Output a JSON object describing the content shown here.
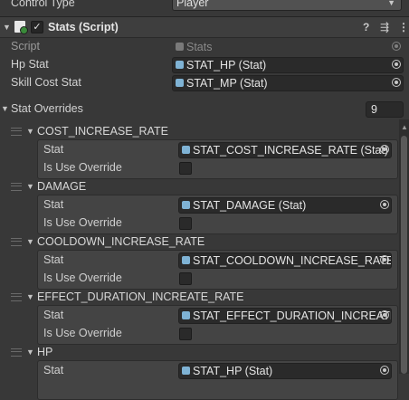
{
  "control_type": {
    "label": "Control Type",
    "value": "Player"
  },
  "component": {
    "title": "Stats (Script)",
    "enabled": true
  },
  "fields": {
    "script": {
      "label": "Script",
      "value": "Stats"
    },
    "hp_stat": {
      "label": "Hp Stat",
      "value": "STAT_HP (Stat)"
    },
    "skill_cost_stat": {
      "label": "Skill Cost Stat",
      "value": "STAT_MP (Stat)"
    }
  },
  "stat_overrides": {
    "label": "Stat Overrides",
    "count": "9",
    "stat_label": "Stat",
    "override_label": "Is Use Override",
    "items": [
      {
        "title": "COST_INCREASE_RATE",
        "stat": "STAT_COST_INCREASE_RATE (Stat)"
      },
      {
        "title": "DAMAGE",
        "stat": "STAT_DAMAGE (Stat)"
      },
      {
        "title": "COOLDOWN_INCREASE_RATE",
        "stat": "STAT_COOLDOWN_INCREASE_RATE (Stat)"
      },
      {
        "title": "EFFECT_DURATION_INCREATE_RATE",
        "stat": "STAT_EFFECT_DURATION_INCREATE_RATE (Stat)"
      },
      {
        "title": "HP",
        "stat": "STAT_HP (Stat)"
      }
    ]
  },
  "icons": {
    "fold": "triangle-down",
    "help": "question-icon",
    "presets": "sliders-icon",
    "menu": "kebab-menu-icon",
    "object_picker": "target-icon"
  }
}
